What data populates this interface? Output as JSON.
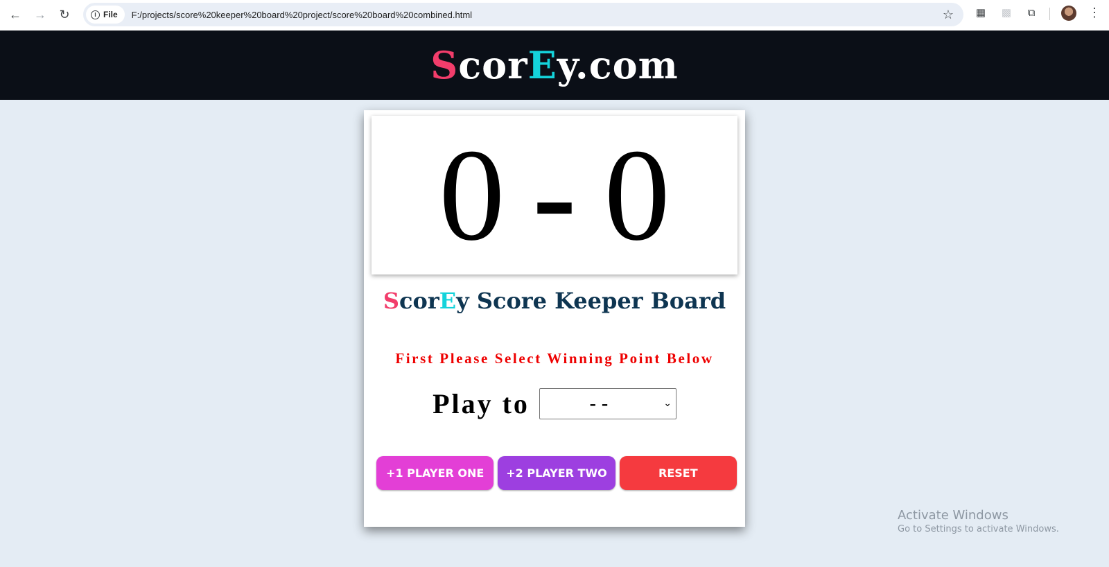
{
  "browser": {
    "file_chip": "File",
    "url": "F:/projects/score%20keeper%20board%20project/score%20board%20combined.html"
  },
  "header": {
    "logo": {
      "s": "S",
      "cor": "cor",
      "e": "E",
      "rest": "y.com"
    }
  },
  "scoreboard": {
    "player_one_score": "0",
    "separator": "-",
    "player_two_score": "0"
  },
  "title": {
    "s": "S",
    "cor": "cor",
    "e": "E",
    "rest": "y Score Keeper Board"
  },
  "instruction": "First Please Select Winning Point Below",
  "play_to": {
    "label": "Play to",
    "selected": "--"
  },
  "buttons": {
    "player_one": "+1 PLAYER ONE",
    "player_two": "+2 PLAYER TWO",
    "reset": "RESET"
  },
  "watermark": {
    "title": "Activate Windows",
    "subtitle": "Go to Settings to activate Windows."
  },
  "colors": {
    "logo_s": "#f23d6b",
    "logo_e": "#14d3db",
    "header_bg": "#0b0f17",
    "page_bg": "#e4ecf4",
    "instruction": "#ee0000",
    "title": "#0e3551",
    "player_one_button": "#e33fd6",
    "player_two_button": "#9d3fe0",
    "reset_button": "#f53a3f"
  }
}
